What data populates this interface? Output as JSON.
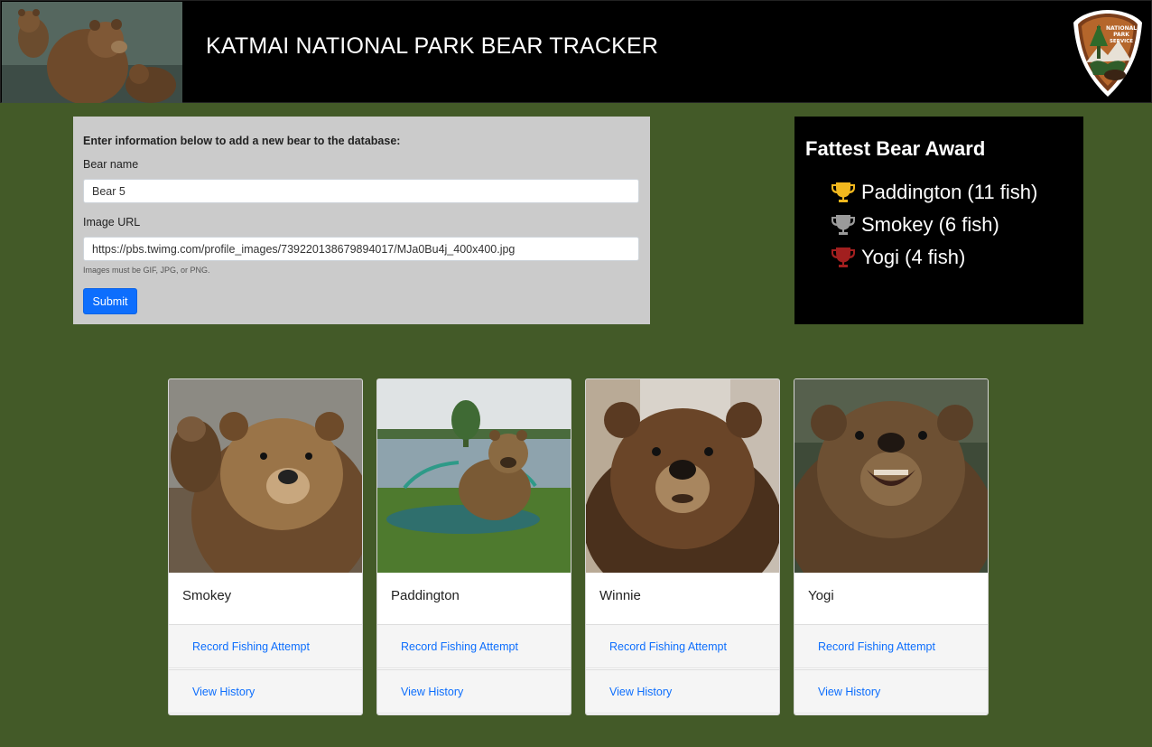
{
  "header": {
    "title": "KATMAI NATIONAL PARK BEAR TRACKER",
    "logo_text": "NATIONAL PARK SERVICE"
  },
  "form": {
    "intro": "Enter information below to add a new bear to the database:",
    "name_label": "Bear name",
    "name_value": "Bear 5",
    "url_label": "Image URL",
    "url_value": "https://pbs.twimg.com/profile_images/739220138679894017/MJa0Bu4j_400x400.jpg",
    "help": "Images must be GIF, JPG, or PNG.",
    "submit_label": "Submit"
  },
  "award": {
    "title": "Fattest Bear Award",
    "entries": [
      {
        "text": "Paddington (11 fish)",
        "trophy_color": "#f2b81e",
        "icon": "gold-trophy-icon"
      },
      {
        "text": "Smokey (6 fish)",
        "trophy_color": "#9a9a9a",
        "icon": "silver-trophy-icon"
      },
      {
        "text": "Yogi (4 fish)",
        "trophy_color": "#a21f1f",
        "icon": "bronze-trophy-icon"
      }
    ]
  },
  "cards": [
    {
      "name": "Smokey",
      "action": "Record Fishing Attempt",
      "history": "View History"
    },
    {
      "name": "Paddington",
      "action": "Record Fishing Attempt",
      "history": "View History"
    },
    {
      "name": "Winnie",
      "action": "Record Fishing Attempt",
      "history": "View History"
    },
    {
      "name": "Yogi",
      "action": "Record Fishing Attempt",
      "history": "View History"
    }
  ],
  "colors": {
    "background": "#435a28",
    "header": "#000000",
    "form_panel": "#cbcbcb",
    "primary": "#0d6efd"
  }
}
